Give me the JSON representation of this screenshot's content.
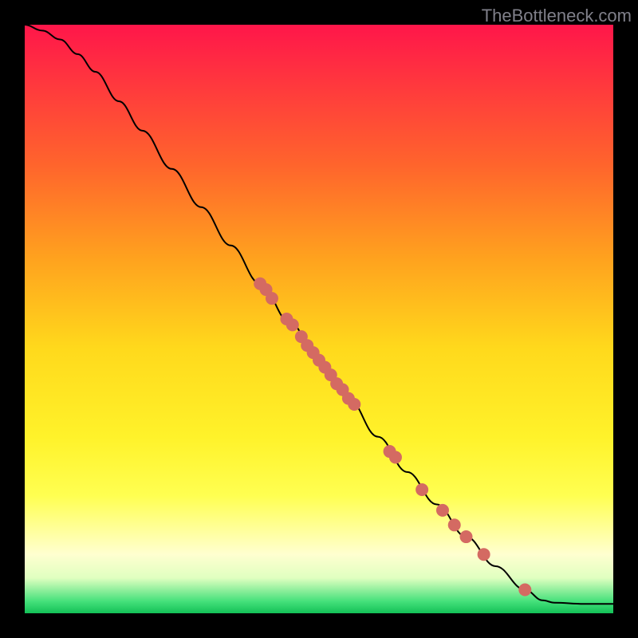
{
  "watermark": "TheBottleneck.com",
  "colors": {
    "curve": "#000000",
    "point_fill": "#d46a62",
    "point_stroke": "#b24d45"
  },
  "chart_data": {
    "type": "line",
    "title": "",
    "xlabel": "",
    "ylabel": "",
    "xlim": [
      0,
      100
    ],
    "ylim": [
      0,
      100
    ],
    "grid": false,
    "legend": false,
    "curve": [
      {
        "x": 0,
        "y": 100
      },
      {
        "x": 3,
        "y": 99
      },
      {
        "x": 6,
        "y": 97.5
      },
      {
        "x": 9,
        "y": 95
      },
      {
        "x": 12,
        "y": 92
      },
      {
        "x": 16,
        "y": 87
      },
      {
        "x": 20,
        "y": 82
      },
      {
        "x": 25,
        "y": 75.5
      },
      {
        "x": 30,
        "y": 69
      },
      {
        "x": 35,
        "y": 62.5
      },
      {
        "x": 40,
        "y": 56
      },
      {
        "x": 45,
        "y": 49.5
      },
      {
        "x": 50,
        "y": 43
      },
      {
        "x": 55,
        "y": 36.5
      },
      {
        "x": 60,
        "y": 30
      },
      {
        "x": 65,
        "y": 24
      },
      {
        "x": 70,
        "y": 18.5
      },
      {
        "x": 75,
        "y": 13
      },
      {
        "x": 80,
        "y": 8
      },
      {
        "x": 85,
        "y": 4
      },
      {
        "x": 88,
        "y": 2.2
      },
      {
        "x": 90,
        "y": 1.8
      },
      {
        "x": 95,
        "y": 1.6
      },
      {
        "x": 100,
        "y": 1.6
      }
    ],
    "points": [
      {
        "x": 40,
        "y": 56
      },
      {
        "x": 41,
        "y": 55
      },
      {
        "x": 42,
        "y": 53.5
      },
      {
        "x": 44.5,
        "y": 50
      },
      {
        "x": 45.5,
        "y": 49
      },
      {
        "x": 47,
        "y": 47
      },
      {
        "x": 48,
        "y": 45.5
      },
      {
        "x": 49,
        "y": 44.3
      },
      {
        "x": 50,
        "y": 43
      },
      {
        "x": 51,
        "y": 41.8
      },
      {
        "x": 52,
        "y": 40.5
      },
      {
        "x": 53,
        "y": 39
      },
      {
        "x": 54,
        "y": 38
      },
      {
        "x": 55,
        "y": 36.5
      },
      {
        "x": 56,
        "y": 35.5
      },
      {
        "x": 62,
        "y": 27.5
      },
      {
        "x": 63,
        "y": 26.5
      },
      {
        "x": 67.5,
        "y": 21
      },
      {
        "x": 71,
        "y": 17.5
      },
      {
        "x": 73,
        "y": 15
      },
      {
        "x": 75,
        "y": 13
      },
      {
        "x": 78,
        "y": 10
      },
      {
        "x": 85,
        "y": 4
      }
    ],
    "point_radius": 8
  }
}
